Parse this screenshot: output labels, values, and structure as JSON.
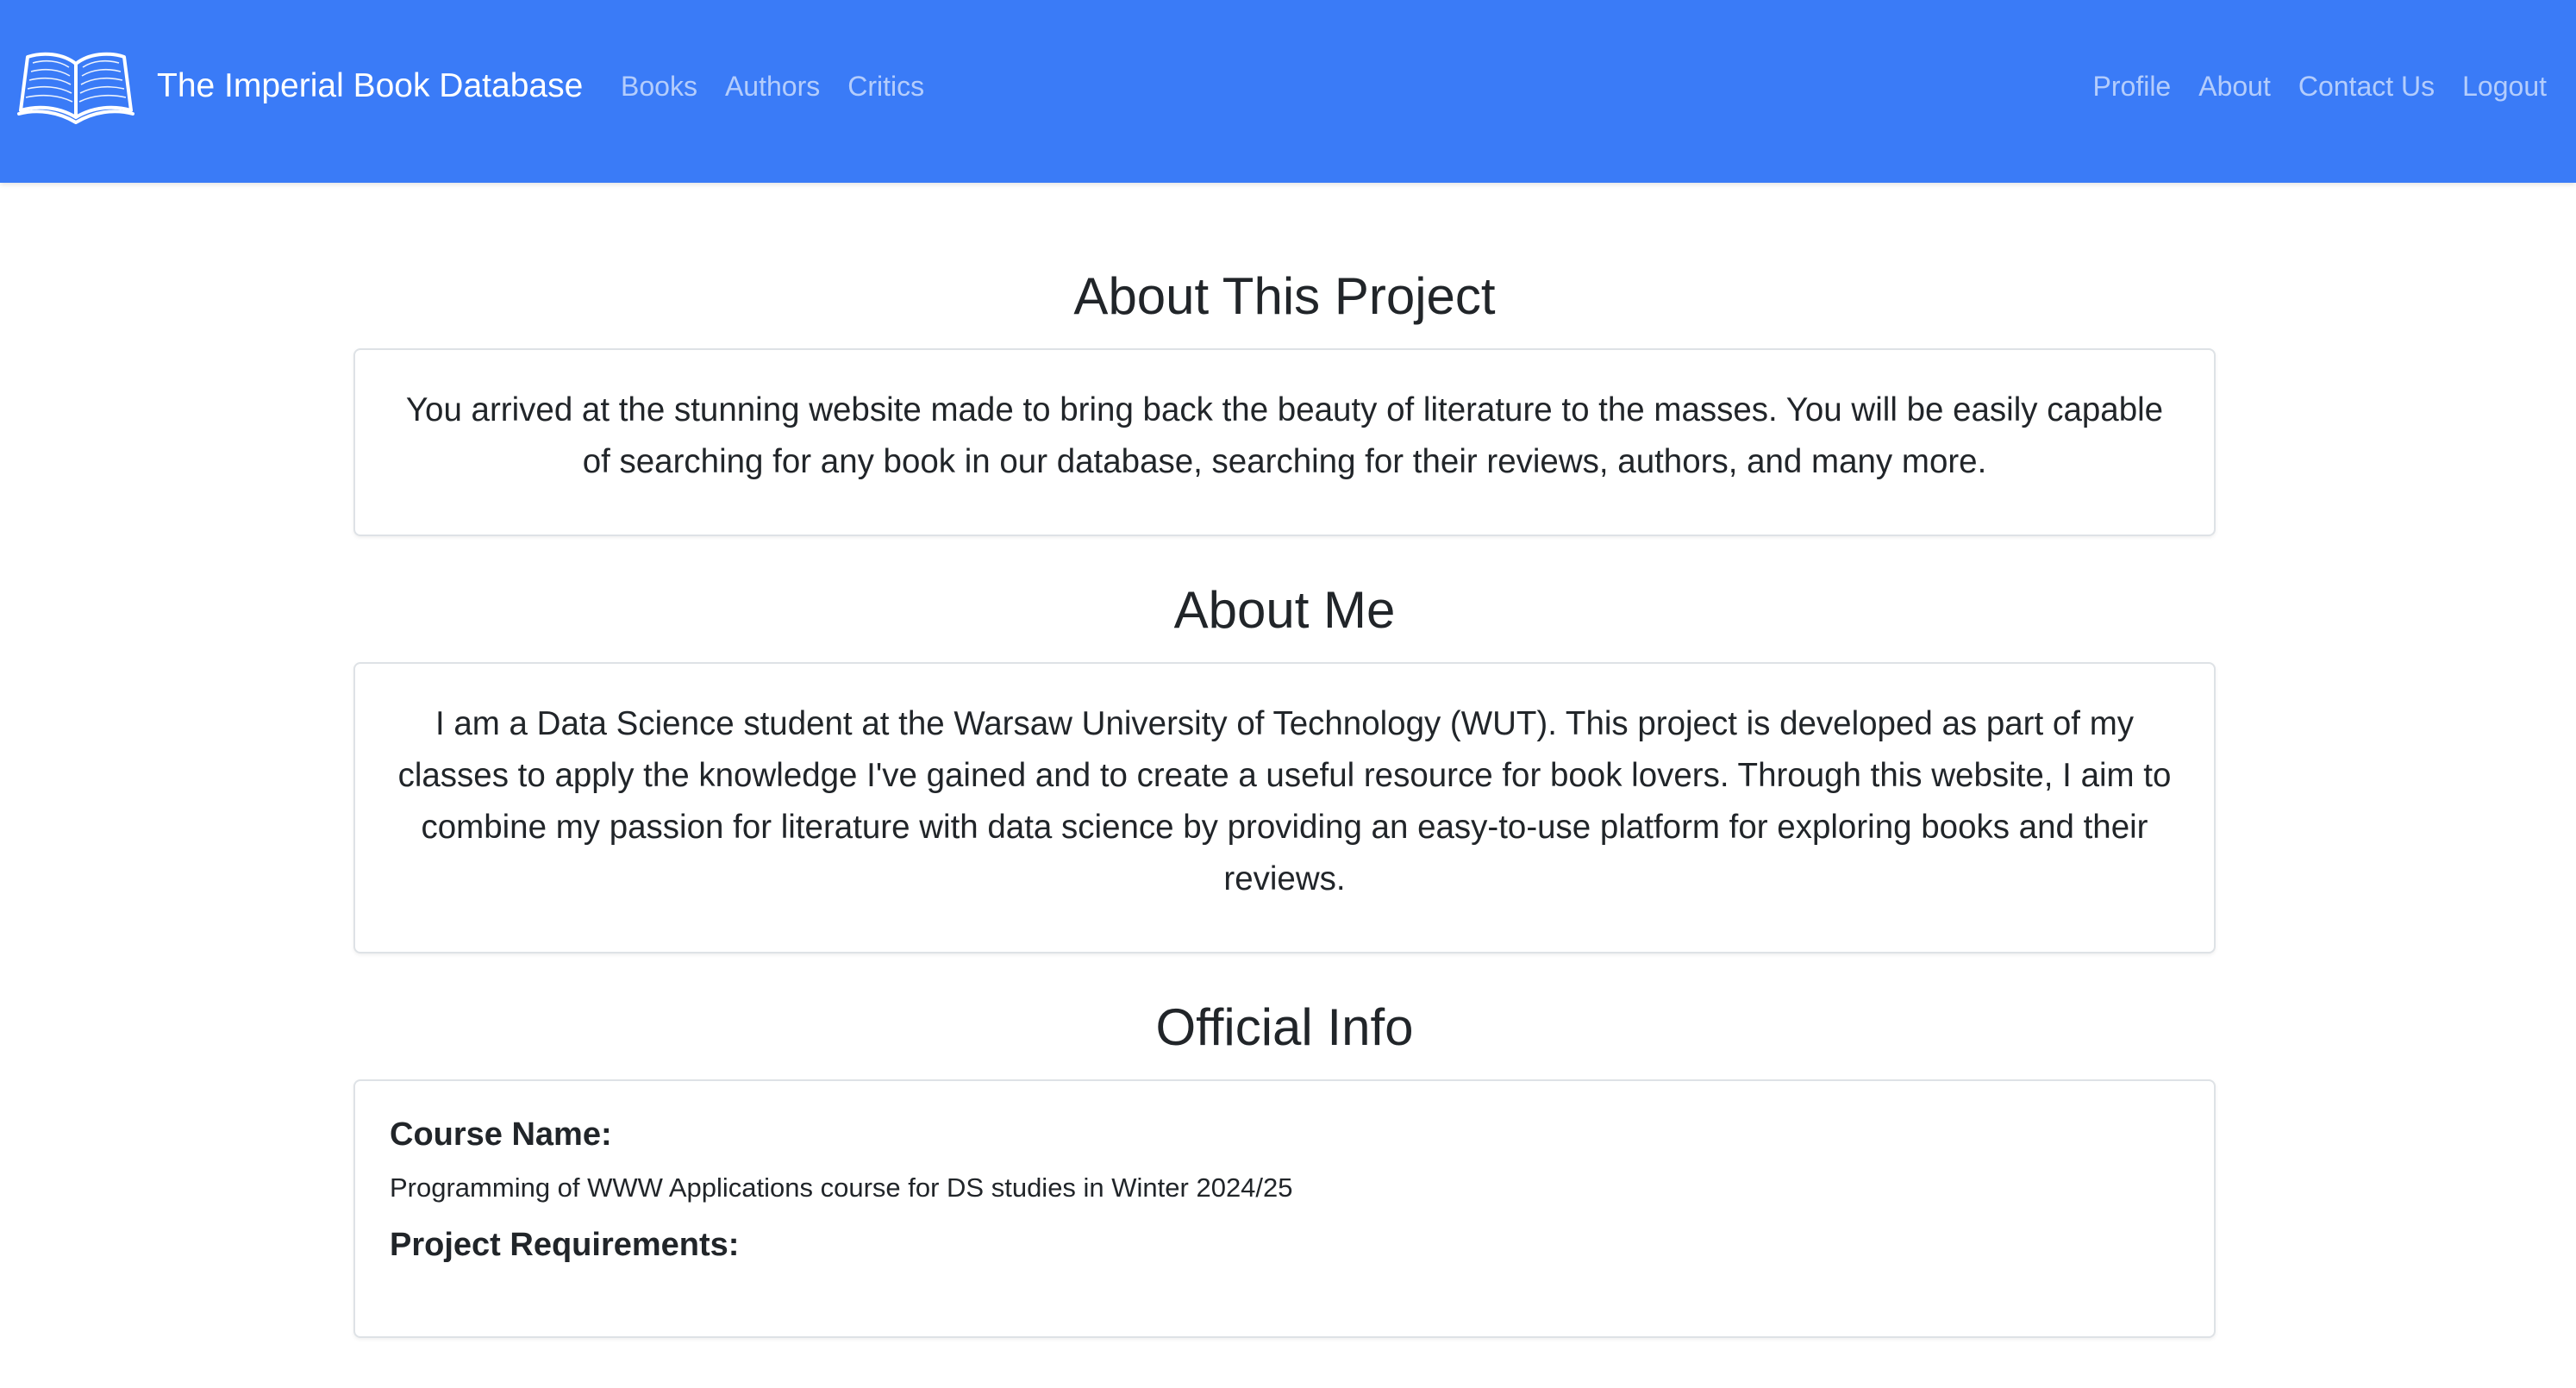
{
  "navbar": {
    "brand": "The Imperial Book Database",
    "logo_icon": "open-book-icon",
    "background_color": "#3a7bf7",
    "left_links": [
      "Books",
      "Authors",
      "Critics"
    ],
    "right_links": [
      "Profile",
      "About",
      "Contact Us",
      "Logout"
    ]
  },
  "about_project": {
    "title": "About This Project",
    "text": "You arrived at the stunning website made to bring back the beauty of literature to the masses. You will be easily capable of searching for any book in our database, searching for their reviews, authors, and many more."
  },
  "about_me": {
    "title": "About Me",
    "text": "I am a Data Science student at the Warsaw University of Technology (WUT). This project is developed as part of my classes to apply the knowledge I've gained and to create a useful resource for book lovers. Through this website, I aim to combine my passion for literature with data science by providing an easy-to-use platform for exploring books and their reviews."
  },
  "official_info": {
    "title": "Official Info",
    "course_label": "Course Name:",
    "course_value": "Programming of WWW Applications course for DS studies in Winter 2024/25",
    "requirements_label": "Project Requirements:"
  }
}
